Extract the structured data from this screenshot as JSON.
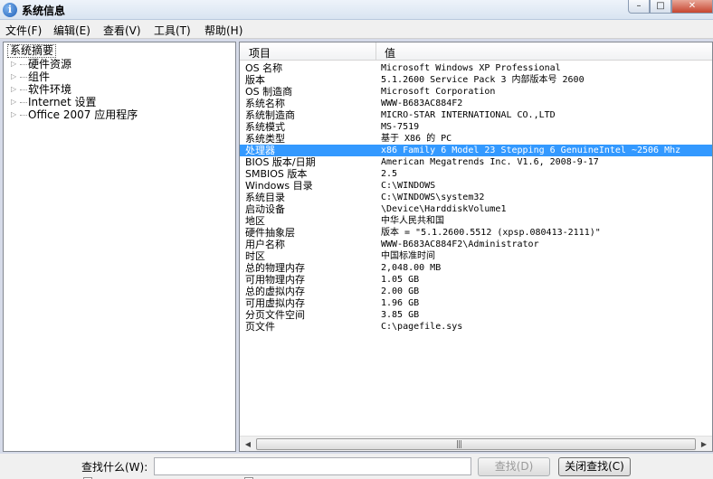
{
  "window": {
    "title": "系统信息",
    "app_icon_glyph": "i"
  },
  "title_buttons": {
    "min": "–",
    "max": "□",
    "close": "✕"
  },
  "menu": [
    {
      "label": "文件(F)"
    },
    {
      "label": "编辑(E)"
    },
    {
      "label": "查看(V)"
    },
    {
      "label": "工具(T)"
    },
    {
      "label": "帮助(H)"
    }
  ],
  "tree": {
    "root": "系统摘要",
    "children": [
      {
        "label": "硬件资源"
      },
      {
        "label": "组件"
      },
      {
        "label": "软件环境"
      },
      {
        "label": "Internet 设置"
      },
      {
        "label": "Office 2007 应用程序"
      }
    ],
    "expander_glyph": "▷"
  },
  "list": {
    "columns": {
      "item": "项目",
      "value": "值"
    },
    "rows": [
      {
        "item": "OS 名称",
        "value": "Microsoft Windows XP Professional"
      },
      {
        "item": "版本",
        "value": "5.1.2600 Service Pack 3 内部版本号 2600"
      },
      {
        "item": "OS 制造商",
        "value": "Microsoft Corporation"
      },
      {
        "item": "系统名称",
        "value": "WWW-B683AC884F2"
      },
      {
        "item": "系统制造商",
        "value": "MICRO-STAR INTERNATIONAL CO.,LTD"
      },
      {
        "item": "系统模式",
        "value": "MS-7519"
      },
      {
        "item": "系统类型",
        "value": "基于 X86 的 PC"
      },
      {
        "item": "处理器",
        "value": "x86 Family 6 Model 23 Stepping 6 GenuineIntel ~2506 Mhz",
        "selected": true
      },
      {
        "item": "BIOS 版本/日期",
        "value": "American Megatrends Inc. V1.6, 2008-9-17"
      },
      {
        "item": "SMBIOS 版本",
        "value": "2.5"
      },
      {
        "item": "Windows 目录",
        "value": "C:\\WINDOWS"
      },
      {
        "item": "系统目录",
        "value": "C:\\WINDOWS\\system32"
      },
      {
        "item": "启动设备",
        "value": "\\Device\\HarddiskVolume1"
      },
      {
        "item": "地区",
        "value": "中华人民共和国"
      },
      {
        "item": "硬件抽象层",
        "value": "版本 = \"5.1.2600.5512 (xpsp.080413-2111)\""
      },
      {
        "item": "用户名称",
        "value": "WWW-B683AC884F2\\Administrator"
      },
      {
        "item": "时区",
        "value": "中国标准时间"
      },
      {
        "item": "总的物理内存",
        "value": "2,048.00 MB"
      },
      {
        "item": "可用物理内存",
        "value": "1.05 GB"
      },
      {
        "item": "总的虚拟内存",
        "value": "2.00 GB"
      },
      {
        "item": "可用虚拟内存",
        "value": "1.96 GB"
      },
      {
        "item": "分页文件空间",
        "value": "3.85 GB"
      },
      {
        "item": "页文件",
        "value": "C:\\pagefile.sys"
      }
    ]
  },
  "hscroll": {
    "left": "◀",
    "right": "▶",
    "grip": "|||"
  },
  "find": {
    "label": "查找什么(W):",
    "value": "",
    "find_button": "查找(D)",
    "close_button": "关闭查找(C)"
  },
  "colors": {
    "selection": "#3399ff",
    "title_bar": "#d9e4f1",
    "close_button": "#c6452f"
  }
}
